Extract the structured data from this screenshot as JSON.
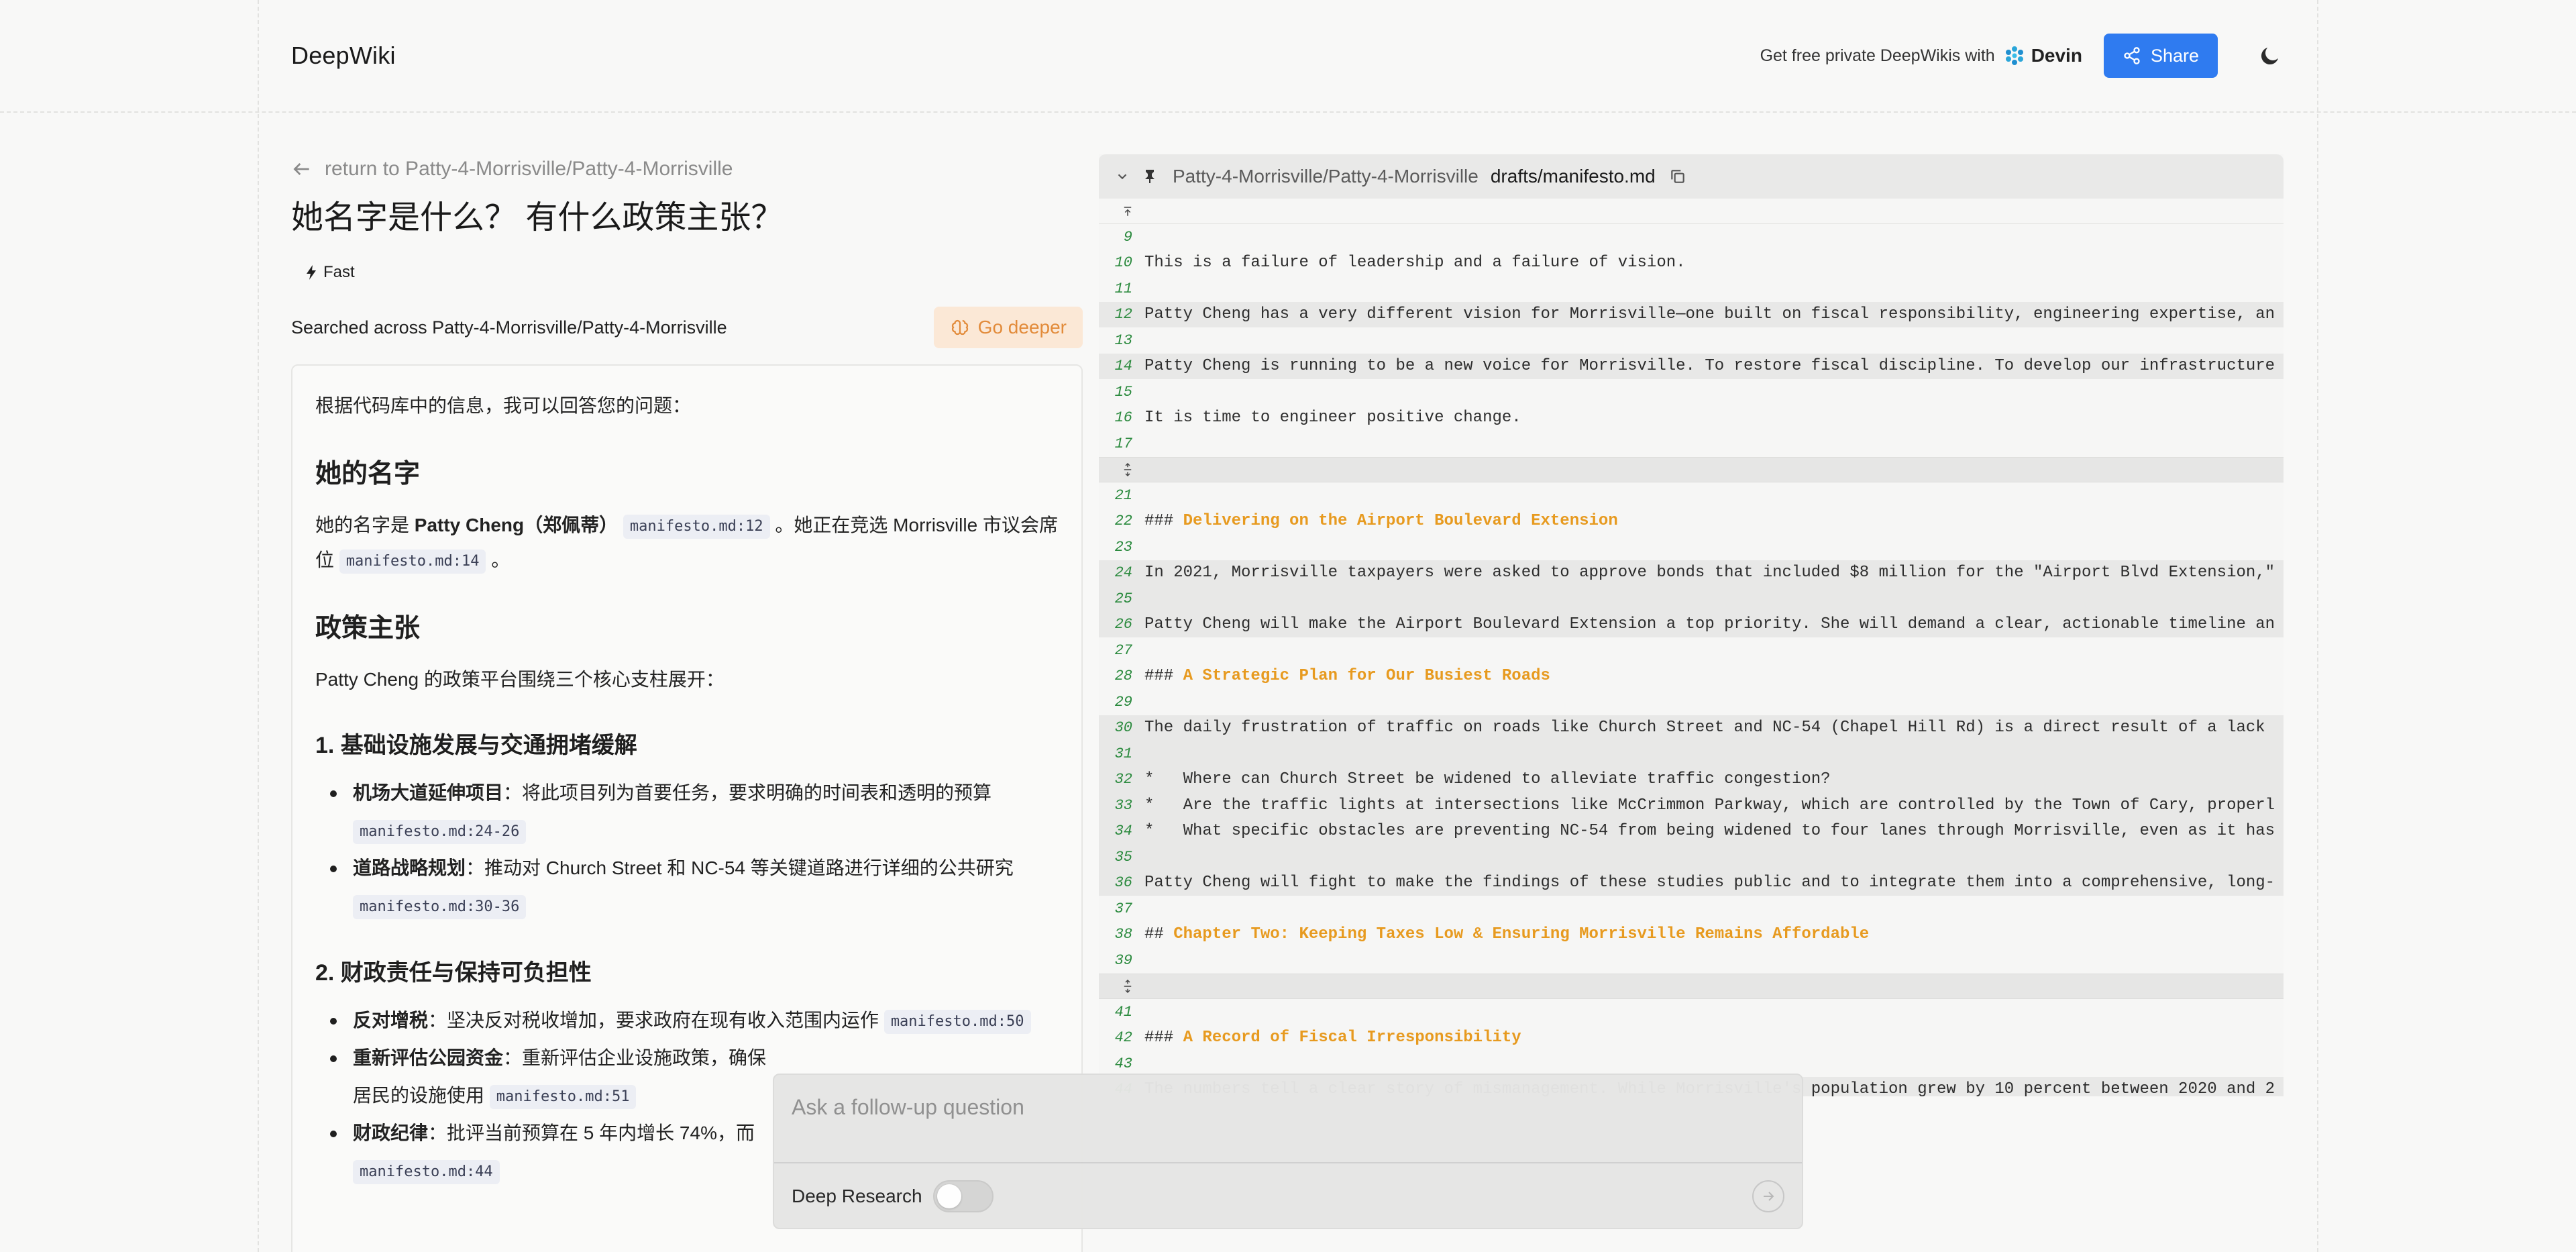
{
  "header": {
    "brand": "DeepWiki",
    "promo_text": "Get free private DeepWikis with",
    "promo_brand": "Devin",
    "share_label": "Share"
  },
  "left": {
    "back_link": "return to Patty-4-Morrisville/Patty-4-Morrisville",
    "question": "她名字是什么？ 有什么政策主张？",
    "mode_badge": "Fast",
    "searched_text": "Searched across Patty-4-Morrisville/Patty-4-Morrisville",
    "go_deeper_label": "Go deeper"
  },
  "answer": {
    "intro": "根据代码库中的信息，我可以回答您的问题：",
    "h_name": "她的名字",
    "name_p1": "她的名字是 ",
    "name_bold": "Patty Cheng（郑佩蒂）",
    "name_ref1": "manifesto.md:12",
    "name_p2": " 。她正在竞选 Morrisville 市议会席位 ",
    "name_ref2": "manifesto.md:14",
    "name_p3": " 。",
    "h_policy": "政策主张",
    "policy_intro": "Patty Cheng 的政策平台围绕三个核心支柱展开：",
    "s1_title": "1. 基础设施发展与交通拥堵缓解",
    "s1_items": [
      {
        "bold": "机场大道延伸项目",
        "text": "：将此项目列为首要任务，要求明确的时间表和透明的预算",
        "ref": "manifesto.md:24-26"
      },
      {
        "bold": "道路战略规划",
        "text": "：推动对 Church Street 和 NC-54 等关键道路进行详细的公共研究",
        "ref": "manifesto.md:30-36"
      }
    ],
    "s2_title": "2. 财政责任与保持可负担性",
    "s2_items": [
      {
        "bold": "反对增税",
        "text": "：坚决反对税收增加，要求政府在现有收入范围内运作",
        "ref": "manifesto.md:50"
      },
      {
        "bold": "重新评估公园资金",
        "text": "：重新评估企业设施政策，确保",
        "text2": "居民的设施使用",
        "ref": "manifesto.md:51"
      },
      {
        "bold": "财政纪律",
        "text": "：批评当前预算在 5 年内增长 74%，而",
        "ref": "manifesto.md:44"
      }
    ]
  },
  "code": {
    "repo": "Patty-4-Morrisville/Patty-4-Morrisville",
    "file": "drafts/manifesto.md",
    "lines": [
      {
        "n": "9",
        "t": "",
        "hl": false
      },
      {
        "n": "10",
        "t": "This is a failure of leadership and a failure of vision.",
        "hl": false
      },
      {
        "n": "11",
        "t": "",
        "hl": false
      },
      {
        "n": "12",
        "t": "Patty Cheng has a very different vision for Morrisville—one built on fiscal responsibility, engineering expertise, an",
        "hl": true
      },
      {
        "n": "13",
        "t": "",
        "hl": false
      },
      {
        "n": "14",
        "t": "Patty Cheng is running to be a new voice for Morrisville. To restore fiscal discipline. To develop our infrastructure",
        "hl": true
      },
      {
        "n": "15",
        "t": "",
        "hl": false
      },
      {
        "n": "16",
        "t": "It is time to engineer positive change.",
        "hl": false
      },
      {
        "n": "17",
        "t": "",
        "hl": false
      },
      {
        "sep": true
      },
      {
        "n": "21",
        "t": "",
        "hl": false
      },
      {
        "n": "22",
        "t": "### ",
        "h": "Delivering on the Airport Boulevard Extension",
        "hl": false
      },
      {
        "n": "23",
        "t": "",
        "hl": false
      },
      {
        "n": "24",
        "t": "In 2021, Morrisville taxpayers were asked to approve bonds that included $8 million for the \"Airport Blvd Extension,\"",
        "hl": true
      },
      {
        "n": "25",
        "t": "",
        "hl": true
      },
      {
        "n": "26",
        "t": "Patty Cheng will make the Airport Boulevard Extension a top priority. She will demand a clear, actionable timeline an",
        "hl": true
      },
      {
        "n": "27",
        "t": "",
        "hl": false
      },
      {
        "n": "28",
        "t": "### ",
        "h": "A Strategic Plan for Our Busiest Roads",
        "hl": false
      },
      {
        "n": "29",
        "t": "",
        "hl": false
      },
      {
        "n": "30",
        "t": "The daily frustration of traffic on roads like Church Street and NC-54 (Chapel Hill Rd) is a direct result of a lack",
        "hl": true
      },
      {
        "n": "31",
        "t": "",
        "hl": true
      },
      {
        "n": "32",
        "t": "*   Where can Church Street be widened to alleviate traffic congestion?",
        "hl": true
      },
      {
        "n": "33",
        "t": "*   Are the traffic lights at intersections like McCrimmon Parkway, which are controlled by the Town of Cary, properl",
        "hl": true
      },
      {
        "n": "34",
        "t": "*   What specific obstacles are preventing NC-54 from being widened to four lanes through Morrisville, even as it has",
        "hl": true
      },
      {
        "n": "35",
        "t": "",
        "hl": true
      },
      {
        "n": "36",
        "t": "Patty Cheng will fight to make the findings of these studies public and to integrate them into a comprehensive, long-",
        "hl": true
      },
      {
        "n": "37",
        "t": "",
        "hl": false
      },
      {
        "n": "38",
        "t": "## ",
        "h": "Chapter Two: Keeping Taxes Low & Ensuring Morrisville Remains Affordable",
        "hl": false
      },
      {
        "n": "39",
        "t": "",
        "hl": false
      },
      {
        "sep": true
      },
      {
        "n": "41",
        "t": "",
        "hl": false
      },
      {
        "n": "42",
        "t": "### ",
        "h": "A Record of Fiscal Irresponsibility",
        "hl": false
      },
      {
        "n": "43",
        "t": "",
        "hl": false
      },
      {
        "n": "44",
        "t": "The numbers tell a clear story of mismanagement. While Morrisville's population grew by 10 percent between 2020 and 2",
        "hl": true
      }
    ]
  },
  "followup": {
    "placeholder": "Ask a follow-up question",
    "deep_research_label": "Deep Research"
  },
  "colors": {
    "accent": "#2f7bf0",
    "go_deeper_bg": "#fbe8d6",
    "go_deeper_fg": "#e28b3a",
    "heading_orange": "#e79a1f",
    "line_number_green": "#2b8a3e"
  }
}
